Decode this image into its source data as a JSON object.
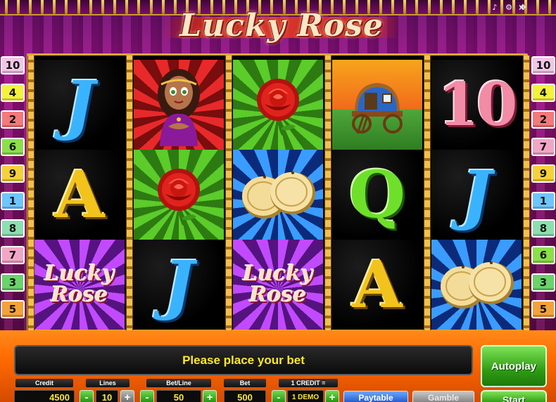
{
  "game": {
    "title": "Lucky Rose",
    "logo_mark": "™"
  },
  "top_bar": {
    "icons": [
      "music-icon",
      "settings-icon",
      "fullscreen-icon"
    ],
    "close_label": "✕"
  },
  "line_badges": {
    "left": [
      {
        "label": "10",
        "color": "#f2c6e6"
      },
      {
        "label": "4",
        "color": "#f5f23a"
      },
      {
        "label": "2",
        "color": "#f37a7a"
      },
      {
        "label": "6",
        "color": "#8be04a"
      },
      {
        "label": "9",
        "color": "#f5d23a"
      },
      {
        "label": "1",
        "color": "#6ec6ff"
      },
      {
        "label": "8",
        "color": "#8be0b0"
      },
      {
        "label": "7",
        "color": "#f2a6c6"
      },
      {
        "label": "3",
        "color": "#6ad36a"
      },
      {
        "label": "5",
        "color": "#f4a23a"
      }
    ],
    "right": [
      {
        "label": "10",
        "color": "#f2c6e6"
      },
      {
        "label": "4",
        "color": "#f5f23a"
      },
      {
        "label": "2",
        "color": "#f37a7a"
      },
      {
        "label": "7",
        "color": "#f2a6c6"
      },
      {
        "label": "9",
        "color": "#f5d23a"
      },
      {
        "label": "1",
        "color": "#6ec6ff"
      },
      {
        "label": "8",
        "color": "#8be0b0"
      },
      {
        "label": "6",
        "color": "#8be04a"
      },
      {
        "label": "3",
        "color": "#6ad36a"
      },
      {
        "label": "5",
        "color": "#f4a23a"
      }
    ]
  },
  "reels": [
    [
      {
        "symbol": "J",
        "bg": "dark"
      },
      {
        "symbol": "A",
        "bg": "dark"
      },
      {
        "symbol": "Lucky Rose",
        "bg": "purple"
      }
    ],
    [
      {
        "symbol": "girl",
        "bg": "red"
      },
      {
        "symbol": "rose",
        "bg": "green"
      },
      {
        "symbol": "J",
        "bg": "dark"
      }
    ],
    [
      {
        "symbol": "rose",
        "bg": "green"
      },
      {
        "symbol": "coins",
        "bg": "blue"
      },
      {
        "symbol": "Lucky Rose",
        "bg": "purple"
      }
    ],
    [
      {
        "symbol": "wagon",
        "bg": "sunset"
      },
      {
        "symbol": "Q",
        "bg": "dark"
      },
      {
        "symbol": "A",
        "bg": "dark"
      }
    ],
    [
      {
        "symbol": "10",
        "bg": "dark"
      },
      {
        "symbol": "J",
        "bg": "dark"
      },
      {
        "symbol": "coins",
        "bg": "blue"
      }
    ]
  ],
  "message": "Please place your bet",
  "controls": {
    "credit_label": "Credit",
    "credit_value": "4500",
    "lines_label": "Lines",
    "lines_value": "10",
    "bet_line_label": "Bet/Line",
    "bet_line_value": "50",
    "bet_label": "Bet",
    "bet_value": "500",
    "denom_label": "1 CREDIT =",
    "denom_value": "1 DEMO",
    "minus": "-",
    "plus": "+",
    "paytable": "Paytable",
    "gamble": "Gamble",
    "autoplay": "Autoplay",
    "start": "Start"
  }
}
